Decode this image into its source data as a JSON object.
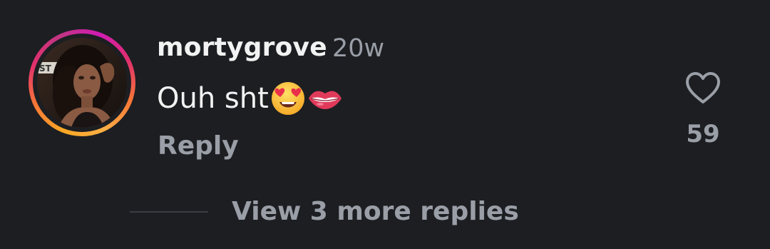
{
  "comment": {
    "username": "mortygrove",
    "timestamp": "20w",
    "text": "Ouh sht",
    "emojis": [
      "smiling-face-with-heart-eyes-emoji",
      "lips-emoji"
    ],
    "reply_label": "Reply",
    "like_count": "59",
    "view_replies_label": "View 3 more replies"
  },
  "avatar": {
    "sign_text": "ST",
    "ring_colors": [
      "#fcaf45",
      "#f77737",
      "#e1306c",
      "#c13584"
    ]
  },
  "colors": {
    "background": "#1c1e22",
    "primary_text": "#f2f2f2",
    "secondary_text": "#9a9ea6"
  }
}
